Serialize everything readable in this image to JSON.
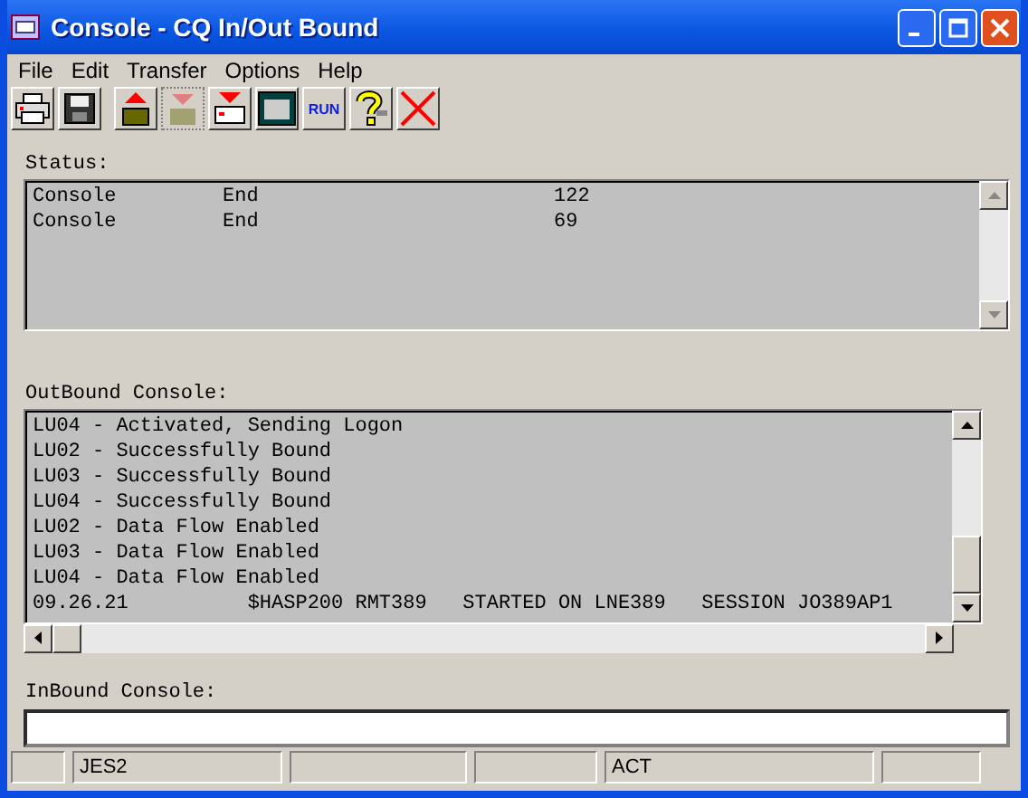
{
  "window": {
    "title": "Console - CQ In/Out Bound"
  },
  "menu": [
    "File",
    "Edit",
    "Transfer",
    "Options",
    "Help"
  ],
  "toolbar": [
    {
      "kind": "print"
    },
    {
      "kind": "save"
    },
    {
      "kind": "upload"
    },
    {
      "kind": "download",
      "disabled": true
    },
    {
      "kind": "receive"
    },
    {
      "kind": "window"
    },
    {
      "kind": "run",
      "label": "RUN"
    },
    {
      "kind": "help"
    },
    {
      "kind": "close"
    }
  ],
  "status": {
    "label": "Status:",
    "rows": [
      {
        "column_1": "Console",
        "column_2": "End",
        "column_3": "122"
      },
      {
        "column_1": "Console",
        "column_2": "End",
        "column_3": "69"
      }
    ]
  },
  "outbound": {
    "label": "OutBound Console:",
    "lines": [
      "LU04 - Activated, Sending Logon",
      "LU02 - Successfully Bound",
      "LU03 - Successfully Bound",
      "LU04 - Successfully Bound",
      "LU02 - Data Flow Enabled",
      "LU03 - Data Flow Enabled",
      "LU04 - Data Flow Enabled",
      "09.26.21          $HASP200 RMT389   STARTED ON LNE389   SESSION JO389AP1"
    ]
  },
  "inbound": {
    "label": "InBound Console:"
  },
  "status_bar": {
    "pane_2": "JES2",
    "pane_5": "ACT"
  }
}
